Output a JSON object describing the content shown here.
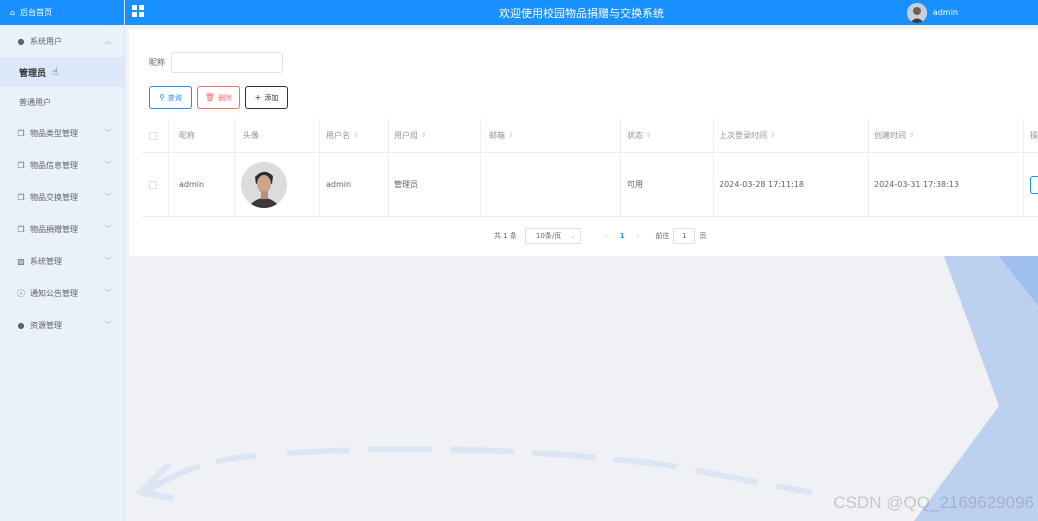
{
  "sidebar": {
    "home": "后台首页",
    "groups": [
      {
        "label": "系统用户",
        "icon": "user-icon",
        "open": true
      },
      {
        "label": "物品类型管理",
        "icon": "box-icon"
      },
      {
        "label": "物品信息管理",
        "icon": "box-icon"
      },
      {
        "label": "物品交换管理",
        "icon": "box-icon"
      },
      {
        "label": "物品捐赠管理",
        "icon": "box-icon"
      },
      {
        "label": "系统管理",
        "icon": "picture-icon"
      },
      {
        "label": "通知公告管理",
        "icon": "info-icon"
      },
      {
        "label": "资源管理",
        "icon": "location-icon"
      }
    ],
    "sub_items": [
      "管理员",
      "普通用户"
    ]
  },
  "header": {
    "title": "欢迎使用校园物品捐赠与交换系统",
    "username": "admin"
  },
  "search": {
    "label": "昵称",
    "value": "",
    "placeholder": ""
  },
  "buttons": {
    "search": "查询",
    "delete": "删除",
    "add": "添加"
  },
  "table": {
    "columns": [
      "昵称",
      "头像",
      "用户名",
      "用户组",
      "邮箱",
      "状态",
      "上次登录时间",
      "创建时间",
      "操"
    ],
    "rows": [
      {
        "nickname": "admin",
        "username": "admin",
        "group": "管理员",
        "email": "",
        "status": "可用",
        "last_login": "2024-03-28 17:11:18",
        "created": "2024-03-31 17:38:13"
      }
    ]
  },
  "pager": {
    "total": "共 1 条",
    "page_size": "10条/页",
    "current": "1",
    "goto_label": "前往",
    "goto_value": "1",
    "page_suffix": "页"
  },
  "watermark": "CSDN @QQ_2169629096",
  "colors": {
    "primary": "#1890ff",
    "danger": "#f56c6c"
  }
}
